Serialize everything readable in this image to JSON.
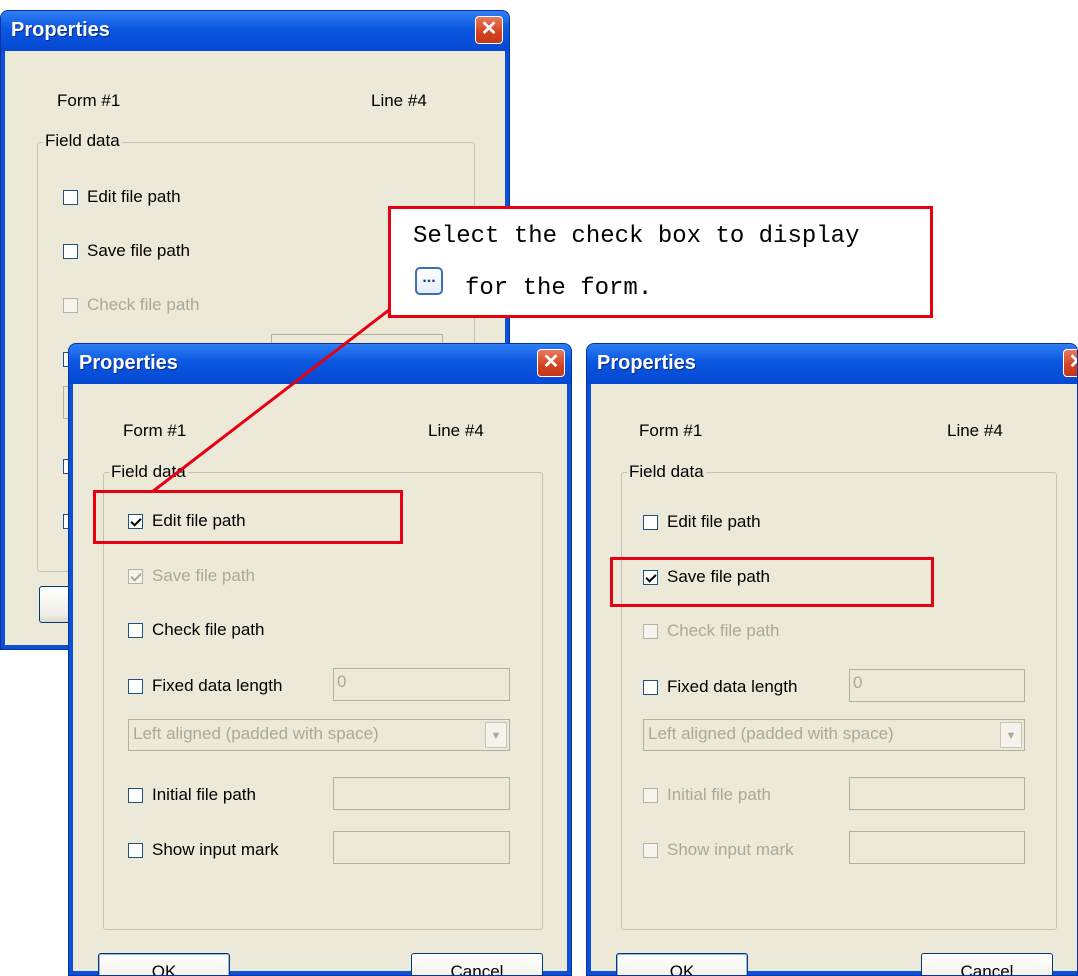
{
  "callout": {
    "line1": "Select the check box to display",
    "line2": "for the form.",
    "icon": "browse-ellipsis-icon",
    "icon_glyph": "...",
    "color": "#e60012"
  },
  "dialogs": [
    {
      "title": "Properties",
      "close_glyph": "✕",
      "form_label": "Form #1",
      "line_label": "Line #4",
      "group_label": "Field data",
      "checkboxes": [
        {
          "label": "Edit file path",
          "checked": false,
          "enabled": true
        },
        {
          "label": "Save file path",
          "checked": false,
          "enabled": true
        },
        {
          "label": "Check file path",
          "checked": false,
          "enabled": false
        }
      ]
    },
    {
      "title": "Properties",
      "close_glyph": "✕",
      "form_label": "Form #1",
      "line_label": "Line #4",
      "group_label": "Field data",
      "checkboxes": [
        {
          "label": "Edit file path",
          "checked": true,
          "enabled": true
        },
        {
          "label": "Save file path",
          "checked": true,
          "enabled": false
        },
        {
          "label": "Check file path",
          "checked": false,
          "enabled": true
        },
        {
          "label": "Fixed data length",
          "checked": false,
          "enabled": true
        },
        {
          "label": "Initial file path",
          "checked": false,
          "enabled": true
        },
        {
          "label": "Show input mark",
          "checked": false,
          "enabled": true
        }
      ],
      "fixed_length_value": "0",
      "alignment_value": "Left aligned (padded with space)",
      "ok_label": "OK",
      "cancel_label": "Cancel"
    },
    {
      "title": "Properties",
      "close_glyph": "✕",
      "form_label": "Form #1",
      "line_label": "Line #4",
      "group_label": "Field data",
      "checkboxes": [
        {
          "label": "Edit file path",
          "checked": false,
          "enabled": true
        },
        {
          "label": "Save file path",
          "checked": true,
          "enabled": true
        },
        {
          "label": "Check file path",
          "checked": false,
          "enabled": false
        },
        {
          "label": "Fixed data length",
          "checked": false,
          "enabled": true
        },
        {
          "label": "Initial file path",
          "checked": false,
          "enabled": false
        },
        {
          "label": "Show input mark",
          "checked": false,
          "enabled": false
        }
      ],
      "fixed_length_value": "0",
      "alignment_value": "Left aligned (padded with space)",
      "ok_label": "OK",
      "cancel_label": "Cancel"
    }
  ]
}
